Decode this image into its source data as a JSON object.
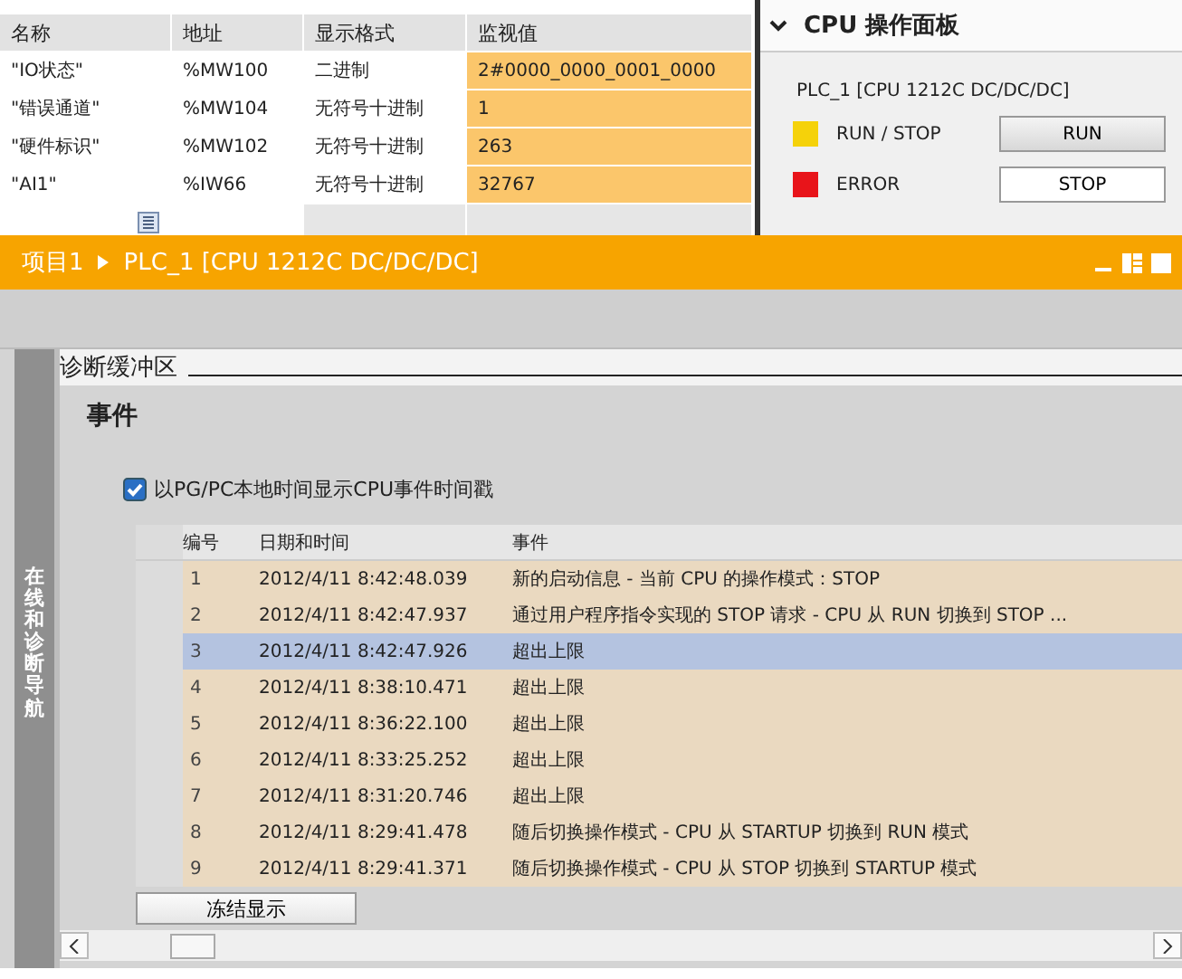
{
  "watch_table": {
    "columns": [
      "名称",
      "地址",
      "显示格式",
      "监视值"
    ],
    "rows": [
      {
        "name": "\"IO状态\"",
        "address": "%MW100",
        "format": "二进制",
        "value": "2#0000_0000_0001_0000"
      },
      {
        "name": "\"错误通道\"",
        "address": "%MW104",
        "format": "无符号十进制",
        "value": "1"
      },
      {
        "name": "\"硬件标识\"",
        "address": "%MW102",
        "format": "无符号十进制",
        "value": "263"
      },
      {
        "name": "\"AI1\"",
        "address": "%IW66",
        "format": "无符号十进制",
        "value": "32767"
      }
    ]
  },
  "cpu_panel": {
    "title": "CPU 操作面板",
    "expanded": true,
    "device": "PLC_1 [CPU 1212C DC/DC/DC]",
    "indicators": [
      {
        "label": "RUN / STOP",
        "color": "#f5d20a",
        "button": "RUN",
        "pressed": true
      },
      {
        "label": "ERROR",
        "color": "#e8141a",
        "button": "STOP",
        "pressed": false
      }
    ]
  },
  "window": {
    "breadcrumb": [
      "项目1",
      "PLC_1 [CPU 1212C DC/DC/DC]"
    ]
  },
  "sidebar": {
    "label": "在线和诊断导航"
  },
  "section": {
    "title": "诊断缓冲区",
    "heading": "事件"
  },
  "checkbox": {
    "label": "以PG/PC本地时间显示CPU事件时间戳",
    "checked": true
  },
  "events": {
    "columns": [
      "编号",
      "日期和时间",
      "事件"
    ],
    "rows": [
      {
        "number": "1",
        "datetime": "2012/4/11 8:42:48.039",
        "event": "新的启动信息 - 当前 CPU 的操作模式：STOP",
        "selected": false
      },
      {
        "number": "2",
        "datetime": "2012/4/11 8:42:47.937",
        "event": "通过用户程序指令实现的 STOP 请求 - CPU 从 RUN 切换到 STOP ...",
        "selected": false
      },
      {
        "number": "3",
        "datetime": "2012/4/11 8:42:47.926",
        "event": "超出上限",
        "selected": true
      },
      {
        "number": "4",
        "datetime": "2012/4/11 8:38:10.471",
        "event": "超出上限",
        "selected": false
      },
      {
        "number": "5",
        "datetime": "2012/4/11 8:36:22.100",
        "event": "超出上限",
        "selected": false
      },
      {
        "number": "6",
        "datetime": "2012/4/11 8:33:25.252",
        "event": "超出上限",
        "selected": false
      },
      {
        "number": "7",
        "datetime": "2012/4/11 8:31:20.746",
        "event": "超出上限",
        "selected": false
      },
      {
        "number": "8",
        "datetime": "2012/4/11 8:29:41.478",
        "event": "随后切换操作模式 - CPU 从 STARTUP 切换到 RUN 模式",
        "selected": false
      },
      {
        "number": "9",
        "datetime": "2012/4/11 8:29:41.371",
        "event": "随后切换操作模式 - CPU 从 STOP 切换到 STARTUP 模式",
        "selected": false
      }
    ]
  },
  "freeze_button": "冻结显示"
}
